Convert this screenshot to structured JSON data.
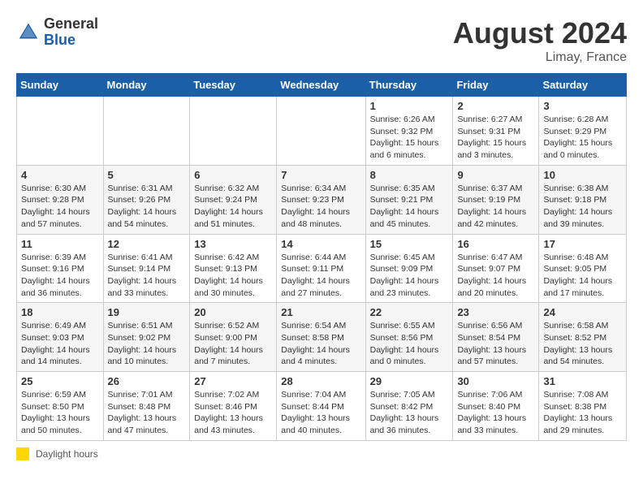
{
  "header": {
    "logo_general": "General",
    "logo_blue": "Blue",
    "month_year": "August 2024",
    "location": "Limay, France"
  },
  "days_of_week": [
    "Sunday",
    "Monday",
    "Tuesday",
    "Wednesday",
    "Thursday",
    "Friday",
    "Saturday"
  ],
  "legend": {
    "label": "Daylight hours"
  },
  "weeks": [
    {
      "days": [
        {
          "num": "",
          "info": ""
        },
        {
          "num": "",
          "info": ""
        },
        {
          "num": "",
          "info": ""
        },
        {
          "num": "",
          "info": ""
        },
        {
          "num": "1",
          "info": "Sunrise: 6:26 AM\nSunset: 9:32 PM\nDaylight: 15 hours\nand 6 minutes."
        },
        {
          "num": "2",
          "info": "Sunrise: 6:27 AM\nSunset: 9:31 PM\nDaylight: 15 hours\nand 3 minutes."
        },
        {
          "num": "3",
          "info": "Sunrise: 6:28 AM\nSunset: 9:29 PM\nDaylight: 15 hours\nand 0 minutes."
        }
      ]
    },
    {
      "days": [
        {
          "num": "4",
          "info": "Sunrise: 6:30 AM\nSunset: 9:28 PM\nDaylight: 14 hours\nand 57 minutes."
        },
        {
          "num": "5",
          "info": "Sunrise: 6:31 AM\nSunset: 9:26 PM\nDaylight: 14 hours\nand 54 minutes."
        },
        {
          "num": "6",
          "info": "Sunrise: 6:32 AM\nSunset: 9:24 PM\nDaylight: 14 hours\nand 51 minutes."
        },
        {
          "num": "7",
          "info": "Sunrise: 6:34 AM\nSunset: 9:23 PM\nDaylight: 14 hours\nand 48 minutes."
        },
        {
          "num": "8",
          "info": "Sunrise: 6:35 AM\nSunset: 9:21 PM\nDaylight: 14 hours\nand 45 minutes."
        },
        {
          "num": "9",
          "info": "Sunrise: 6:37 AM\nSunset: 9:19 PM\nDaylight: 14 hours\nand 42 minutes."
        },
        {
          "num": "10",
          "info": "Sunrise: 6:38 AM\nSunset: 9:18 PM\nDaylight: 14 hours\nand 39 minutes."
        }
      ]
    },
    {
      "days": [
        {
          "num": "11",
          "info": "Sunrise: 6:39 AM\nSunset: 9:16 PM\nDaylight: 14 hours\nand 36 minutes."
        },
        {
          "num": "12",
          "info": "Sunrise: 6:41 AM\nSunset: 9:14 PM\nDaylight: 14 hours\nand 33 minutes."
        },
        {
          "num": "13",
          "info": "Sunrise: 6:42 AM\nSunset: 9:13 PM\nDaylight: 14 hours\nand 30 minutes."
        },
        {
          "num": "14",
          "info": "Sunrise: 6:44 AM\nSunset: 9:11 PM\nDaylight: 14 hours\nand 27 minutes."
        },
        {
          "num": "15",
          "info": "Sunrise: 6:45 AM\nSunset: 9:09 PM\nDaylight: 14 hours\nand 23 minutes."
        },
        {
          "num": "16",
          "info": "Sunrise: 6:47 AM\nSunset: 9:07 PM\nDaylight: 14 hours\nand 20 minutes."
        },
        {
          "num": "17",
          "info": "Sunrise: 6:48 AM\nSunset: 9:05 PM\nDaylight: 14 hours\nand 17 minutes."
        }
      ]
    },
    {
      "days": [
        {
          "num": "18",
          "info": "Sunrise: 6:49 AM\nSunset: 9:03 PM\nDaylight: 14 hours\nand 14 minutes."
        },
        {
          "num": "19",
          "info": "Sunrise: 6:51 AM\nSunset: 9:02 PM\nDaylight: 14 hours\nand 10 minutes."
        },
        {
          "num": "20",
          "info": "Sunrise: 6:52 AM\nSunset: 9:00 PM\nDaylight: 14 hours\nand 7 minutes."
        },
        {
          "num": "21",
          "info": "Sunrise: 6:54 AM\nSunset: 8:58 PM\nDaylight: 14 hours\nand 4 minutes."
        },
        {
          "num": "22",
          "info": "Sunrise: 6:55 AM\nSunset: 8:56 PM\nDaylight: 14 hours\nand 0 minutes."
        },
        {
          "num": "23",
          "info": "Sunrise: 6:56 AM\nSunset: 8:54 PM\nDaylight: 13 hours\nand 57 minutes."
        },
        {
          "num": "24",
          "info": "Sunrise: 6:58 AM\nSunset: 8:52 PM\nDaylight: 13 hours\nand 54 minutes."
        }
      ]
    },
    {
      "days": [
        {
          "num": "25",
          "info": "Sunrise: 6:59 AM\nSunset: 8:50 PM\nDaylight: 13 hours\nand 50 minutes."
        },
        {
          "num": "26",
          "info": "Sunrise: 7:01 AM\nSunset: 8:48 PM\nDaylight: 13 hours\nand 47 minutes."
        },
        {
          "num": "27",
          "info": "Sunrise: 7:02 AM\nSunset: 8:46 PM\nDaylight: 13 hours\nand 43 minutes."
        },
        {
          "num": "28",
          "info": "Sunrise: 7:04 AM\nSunset: 8:44 PM\nDaylight: 13 hours\nand 40 minutes."
        },
        {
          "num": "29",
          "info": "Sunrise: 7:05 AM\nSunset: 8:42 PM\nDaylight: 13 hours\nand 36 minutes."
        },
        {
          "num": "30",
          "info": "Sunrise: 7:06 AM\nSunset: 8:40 PM\nDaylight: 13 hours\nand 33 minutes."
        },
        {
          "num": "31",
          "info": "Sunrise: 7:08 AM\nSunset: 8:38 PM\nDaylight: 13 hours\nand 29 minutes."
        }
      ]
    }
  ]
}
